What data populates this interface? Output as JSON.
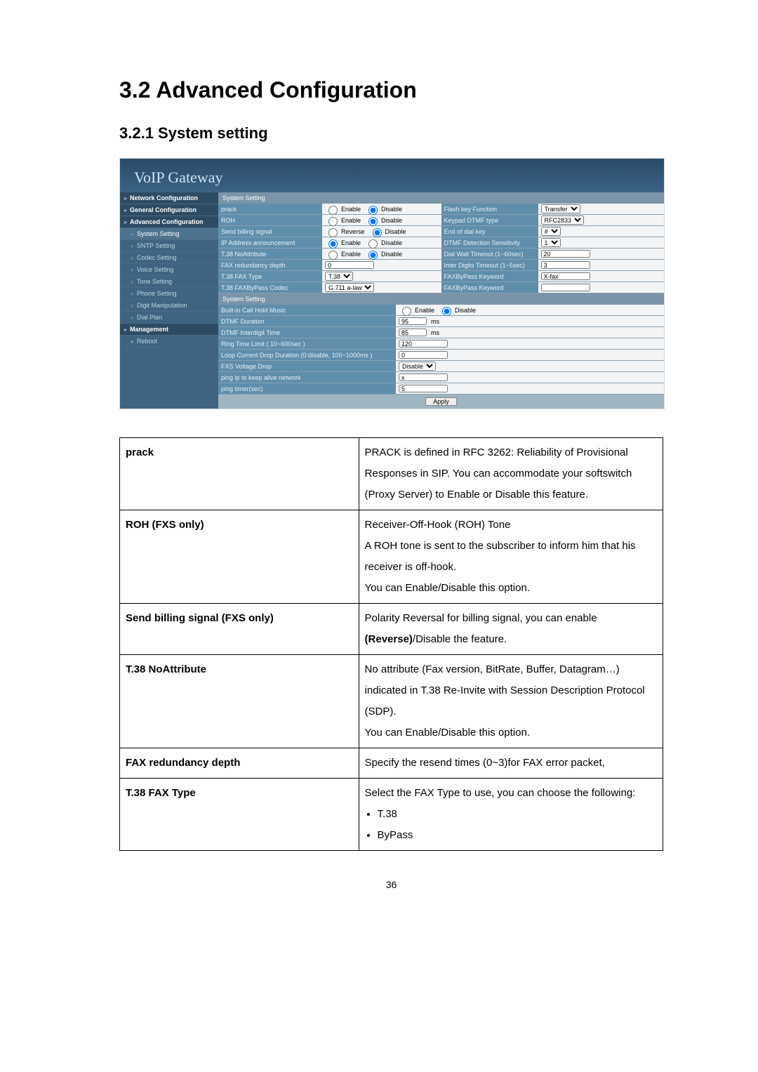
{
  "headings": {
    "h1": "3.2 Advanced Configuration",
    "h2": "3.2.1  System setting"
  },
  "screenshot": {
    "title": "VoIP Gateway",
    "sidebar_groups": [
      {
        "label": "Network Configuration",
        "items": []
      },
      {
        "label": "General Configuration",
        "items": []
      },
      {
        "label": "Advanced Configuration",
        "items": [
          {
            "label": "System Setting",
            "selected": true
          },
          {
            "label": "SNTP Setting"
          },
          {
            "label": "Codec Setting"
          },
          {
            "label": "Voice Setting"
          },
          {
            "label": "Tone Setting"
          },
          {
            "label": "Phone Setting"
          },
          {
            "label": "Digit Manipulation"
          },
          {
            "label": "Dial Plan"
          }
        ]
      },
      {
        "label": "Management",
        "items": []
      },
      {
        "label": "Reboot",
        "items": [],
        "bare": true
      }
    ],
    "section1_title": "System Setting",
    "section1_left": [
      {
        "label": "prack",
        "ctrl": "ed",
        "val": "Disable"
      },
      {
        "label": "ROH",
        "ctrl": "ed",
        "val": "Disable"
      },
      {
        "label": "Send billing signal",
        "ctrl": "rd",
        "val": "Disable"
      },
      {
        "label": "IP Address announcement",
        "ctrl": "ed",
        "val": "Enable"
      },
      {
        "label": "T.38 NoAttribute",
        "ctrl": "ed",
        "val": "Disable"
      },
      {
        "label": "FAX redundancy depth",
        "ctrl": "text",
        "val": "0"
      },
      {
        "label": "T.38 FAX Type",
        "ctrl": "select",
        "val": "T.38"
      },
      {
        "label": "T.38 FAXByPass Codec",
        "ctrl": "select",
        "val": "G.711 a-law"
      }
    ],
    "section1_right": [
      {
        "label": "Flash key Function",
        "ctrl": "select",
        "val": "Transfer"
      },
      {
        "label": "Keypad DTMF type",
        "ctrl": "select",
        "val": "RFC2833"
      },
      {
        "label": "End of dial key",
        "ctrl": "select",
        "val": "#"
      },
      {
        "label": "DTMF Detection Sensitivity",
        "ctrl": "select",
        "val": "1"
      },
      {
        "label": "Dial Wait Timeout (1~60sec)",
        "ctrl": "text",
        "val": "20"
      },
      {
        "label": "Inter Digits Timeout (1~5sec)",
        "ctrl": "text",
        "val": "3"
      },
      {
        "label": "FAXByPass Keyword",
        "ctrl": "text",
        "val": "X-fax"
      },
      {
        "label": "FAXByPass Keyword",
        "ctrl": "text",
        "val": ""
      }
    ],
    "section2_title": "System Setting",
    "section2_rows": [
      {
        "label": "Built-in Call Hold Music",
        "ctrl": "ed",
        "val": "Disable"
      },
      {
        "label": "DTMF Duration",
        "ctrl": "textms",
        "val": "95"
      },
      {
        "label": "DTMF Interdigit Time",
        "ctrl": "textms",
        "val": "85"
      },
      {
        "label": "Ring Time Limit ( 10~600sec )",
        "ctrl": "text",
        "val": "120"
      },
      {
        "label": "Loop Current Drop Duration (0:disable, 100~1000ms )",
        "ctrl": "text",
        "val": "0"
      },
      {
        "label": "FXS Voltage Drop",
        "ctrl": "select",
        "val": "Disable"
      },
      {
        "label": "ping ip to keep alive network",
        "ctrl": "text",
        "val": "x"
      },
      {
        "label": "ping timer(sec)",
        "ctrl": "text",
        "val": "5"
      }
    ],
    "apply_label": "Apply"
  },
  "desc_table": [
    {
      "k": "prack",
      "v": "PRACK is defined in RFC 3262: Reliability of Provisional Responses in SIP. You can accommodate your softswitch (Proxy Server) to Enable or Disable this feature."
    },
    {
      "k": "ROH (FXS only)",
      "v": "Receiver-Off-Hook (ROH) Tone\nA ROH tone is sent to the subscriber to inform him that his receiver is off-hook.\nYou can Enable/Disable this option."
    },
    {
      "k": "Send billing signal (FXS only)",
      "v": "Polarity Reversal for billing signal, you can enable <b>(Reverse)</b>/Disable the feature."
    },
    {
      "k": "T.38 NoAttribute",
      "v": "No attribute (Fax version, BitRate, Buffer, Datagram…) indicated in T.38 Re-Invite with Session Description Protocol (SDP).\nYou can Enable/Disable this option."
    },
    {
      "k": "FAX redundancy depth",
      "v": "Specify the resend times (0~3)for FAX error packet,"
    },
    {
      "k": "T.38 FAX Type",
      "v": "Select the FAX Type to use, you can choose the following:",
      "list": [
        "T.38",
        "ByPass"
      ]
    }
  ],
  "page_number": "36"
}
